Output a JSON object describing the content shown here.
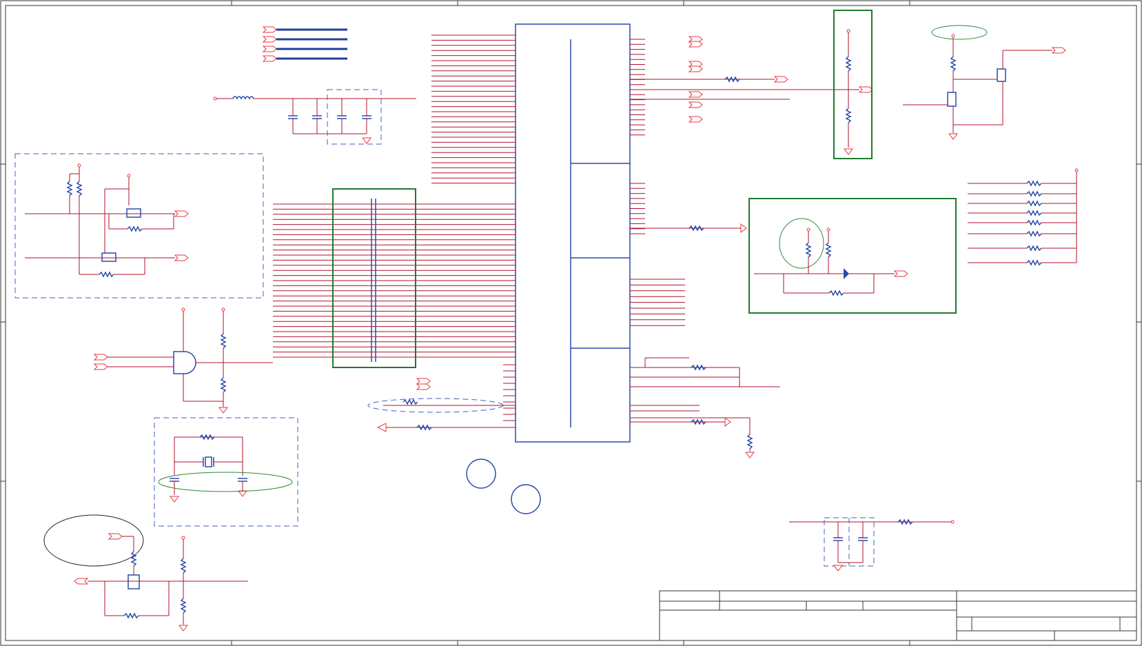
{
  "diagram": {
    "kind": "electronic schematic sheet",
    "colors": {
      "wire": "#b0102a",
      "pin": "#e8343c",
      "component_body": "#2b4aa8",
      "highlight_box": "#1e7a2e",
      "dashed_group": "#4060c0",
      "frame": "#333333"
    },
    "icons": [
      "resistor-icon",
      "capacitor-icon",
      "inductor-icon",
      "mosfet-icon",
      "and-gate-icon",
      "crystal-icon",
      "zener-diode-icon",
      "ground-icon",
      "power-pin-icon",
      "offpage-connector-icon"
    ],
    "text_labels": []
  }
}
